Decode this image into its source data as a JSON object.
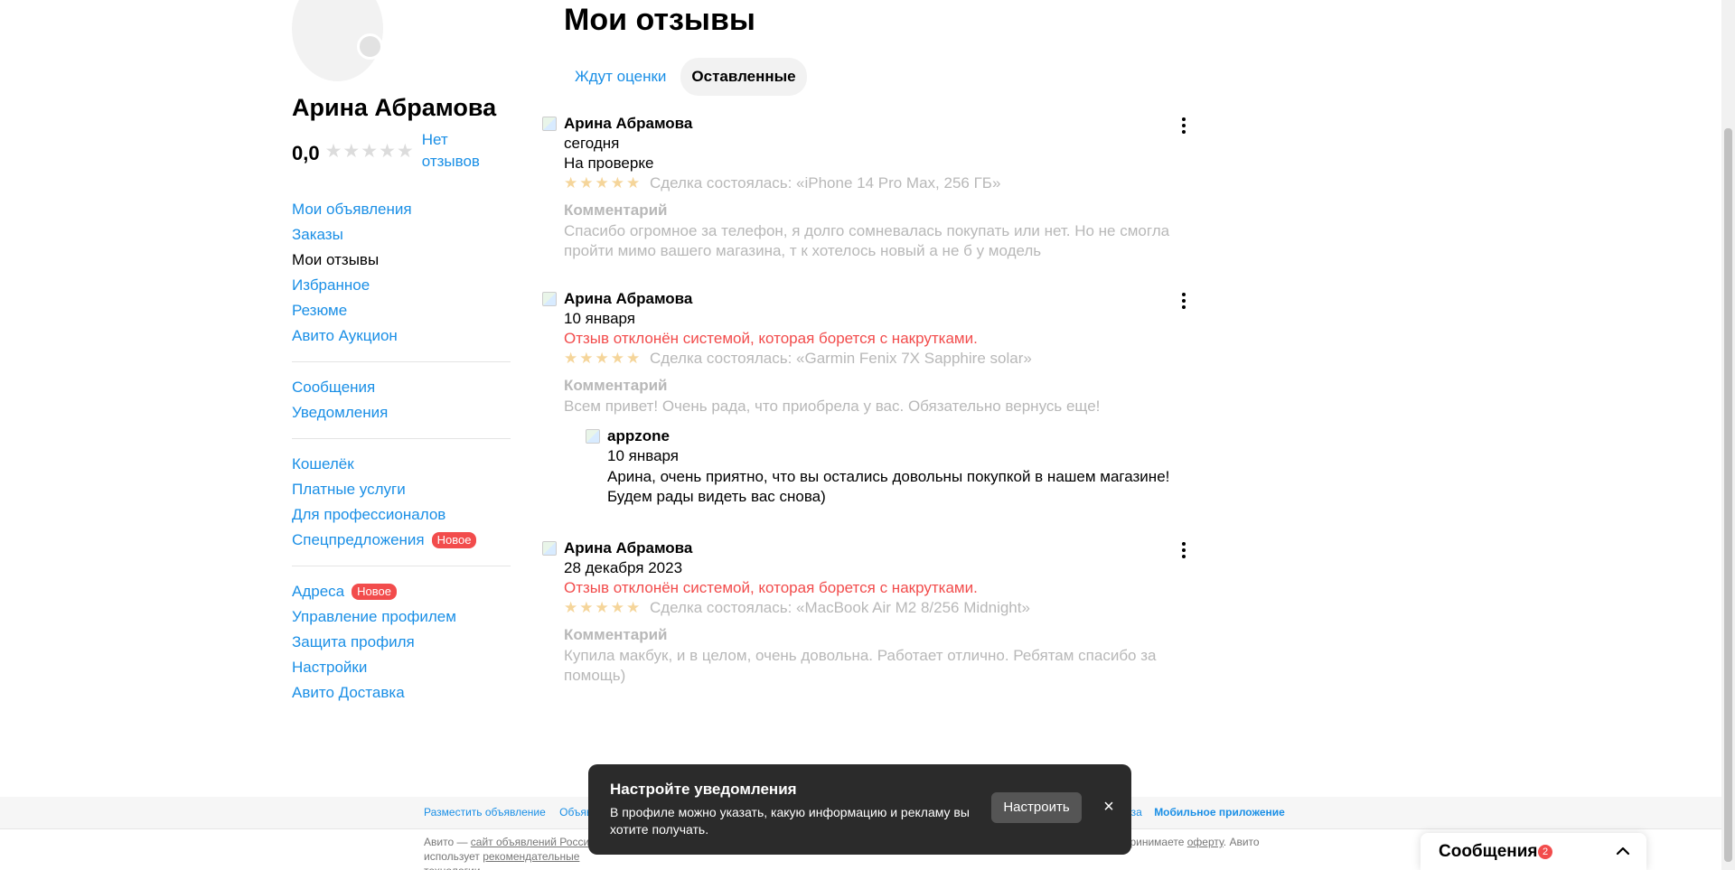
{
  "profile": {
    "name": "Арина Абрамова",
    "rating": "0,0",
    "stars": "★★★★★",
    "no_reviews": "Нет отзывов"
  },
  "menu": {
    "group1": [
      "Мои объявления",
      "Заказы",
      "Мои отзывы",
      "Избранное",
      "Резюме",
      "Авито Аукцион"
    ],
    "group2": [
      "Сообщения",
      "Уведомления"
    ],
    "group3": [
      "Кошелёк",
      "Платные услуги",
      "Для профессионалов",
      "Спецпредложения"
    ],
    "group4": [
      "Адреса",
      "Управление профилем",
      "Защита профиля",
      "Настройки",
      "Авито Доставка"
    ],
    "badge_new": "Новое"
  },
  "page": {
    "title": "Мои отзывы",
    "tabs": [
      "Ждут оценки",
      "Оставленные"
    ]
  },
  "reviews": [
    {
      "author": "Арина Абрамова",
      "date": "сегодня",
      "status": "На проверке",
      "stars": "★★★★★",
      "deal": "Сделка состоялась: «iPhone 14 Pro Max, 256 ГБ»",
      "comment_title": "Комментарий",
      "comment": "Спасибо огромное за телефон, я долго сомневалась покупать или нет. Но не смогла пройти мимо вашего магазина, т к хотелось новый а не б у модель"
    },
    {
      "author": "Арина Абрамова",
      "date": "10 января",
      "status": "Отзыв отклонён системой, которая борется с накрутками.",
      "stars": "★★★★★",
      "deal": "Сделка состоялась: «Garmin Fenix 7X Sapphire solar»",
      "comment_title": "Комментарий",
      "comment": "Всем привет! Очень рада, что приобрела у вас. Обязательно вернусь еще!",
      "reply": {
        "author": "appzone",
        "date": "10 января",
        "text": "Арина, очень приятно, что вы остались довольны покупкой в нашем магазине! Будем рады видеть вас снова)"
      }
    },
    {
      "author": "Арина Абрамова",
      "date": "28 декабря 2023",
      "status": "Отзыв отклонён системой, которая борется с накрутками.",
      "stars": "★★★★★",
      "deal": "Сделка состоялась: «MacBook Air M2 8/256 Midnight»",
      "comment_title": "Комментарий",
      "comment": "Купила макбук, и в целом, очень довольна. Работает отлично. Ребятам спасибо за помощь)"
    }
  ],
  "footer": {
    "link1": "Разместить объявление",
    "link2": "Объяв",
    "link_right_partial": "ольза",
    "mobile_app": "Мобильное приложение",
    "legal_left_prefix": "Авито — ",
    "legal_left_link": "сайт объявлений России",
    "legal_left_suffix": ".",
    "legal_left_line2_prefix": "использует ",
    "legal_left_line2_link": "рекомендательные технологии",
    "legal_left_line2_suffix": ".",
    "legal_right_prefix": "ы принимаете ",
    "legal_right_link": "оферту",
    "legal_right_suffix": ". Авито"
  },
  "toast": {
    "title": "Настройте уведомления",
    "text": "В профиле можно указать, какую информацию и рекламу вы хотите получать.",
    "button": "Настроить",
    "close": "×"
  },
  "messages_widget": {
    "label": "Сообщения",
    "count": "2"
  },
  "colors": {
    "link": "#1a8fe6",
    "error": "#f24c4c",
    "muted": "#b8b8b8",
    "star_filled": "#f5d59a"
  }
}
